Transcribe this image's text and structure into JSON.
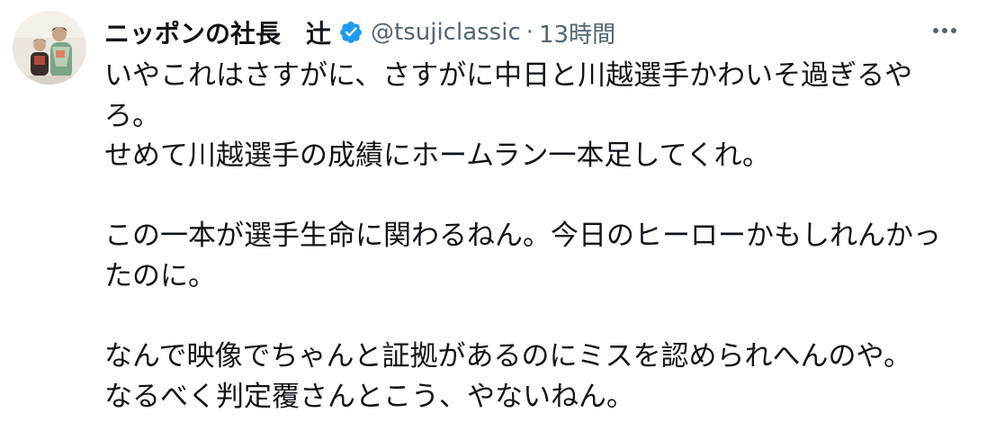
{
  "tweet": {
    "author": {
      "display_name": "ニッポンの社長　辻",
      "verified_icon": "verified-badge-icon",
      "handle": "@tsujiclassic",
      "separator": "·",
      "time": "13時間"
    },
    "more_icon": "more-options-icon",
    "lines": [
      "いやこれはさすがに、さすがに中日と川越選手かわいそ過ぎるや",
      "ろ。",
      "せめて川越選手の成績にホームラン一本足してくれ。",
      "",
      "この一本が選手生命に関わるねん。今日のヒーローかもしれんかっ",
      "たのに。",
      "",
      "なんで映像でちゃんと証拠があるのにミスを認められへんのや。",
      "なるべく判定覆さんとこう、やないねん。"
    ]
  },
  "colors": {
    "text": "#0f1419",
    "secondary": "#536471",
    "verified": "#1d9bf0"
  }
}
